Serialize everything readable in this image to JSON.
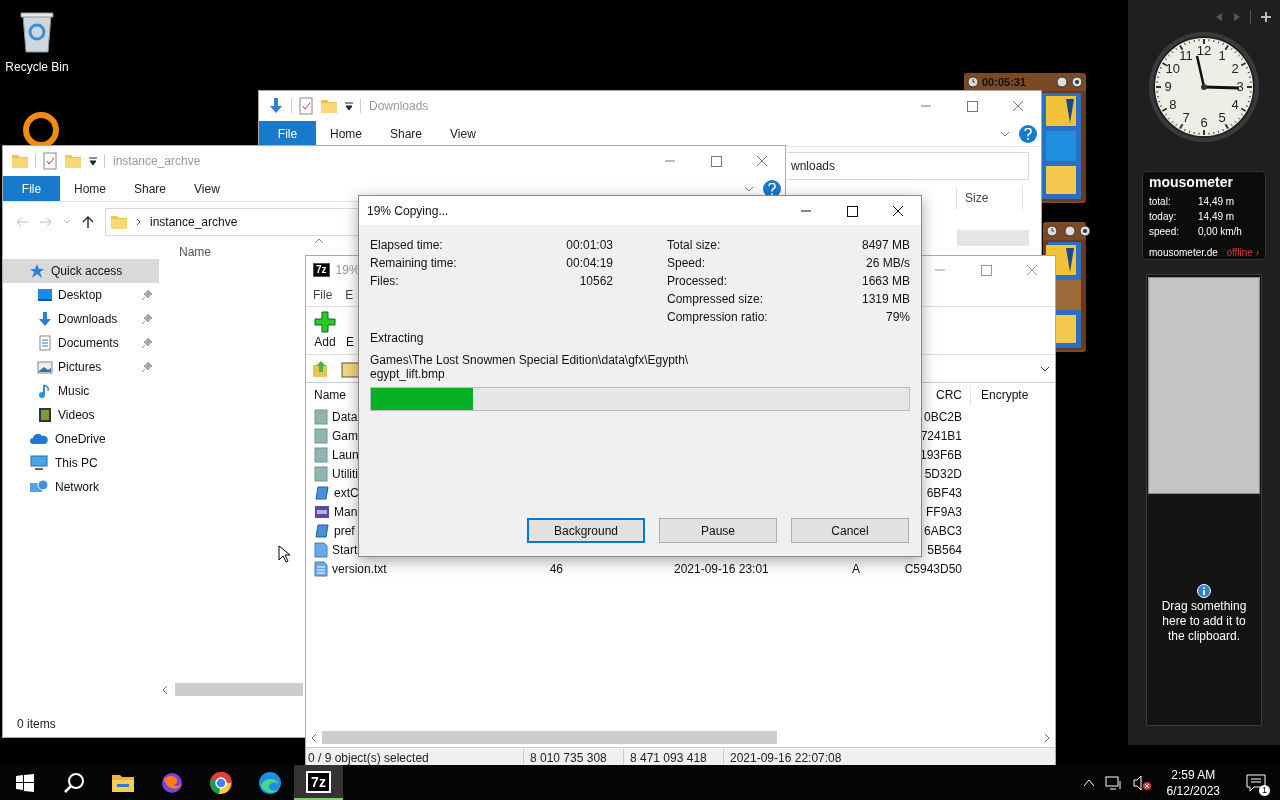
{
  "desktop_icons": [
    {
      "label": "Recycle Bin"
    }
  ],
  "timer_gadget": {
    "time": "00:05:31"
  },
  "downloads_window": {
    "title": "Downloads",
    "ribbon_tabs": [
      {
        "label": "File",
        "kind": "file"
      },
      {
        "label": "Home",
        "kind": "tab"
      },
      {
        "label": "Share",
        "kind": "tab"
      },
      {
        "label": "View",
        "kind": "tab"
      }
    ],
    "address": "wnloads",
    "column": "Size"
  },
  "explorer_window": {
    "title": "instance_archve",
    "ribbon_tabs": [
      {
        "label": "File",
        "kind": "file"
      },
      {
        "label": "Home",
        "kind": "tab"
      },
      {
        "label": "Share",
        "kind": "tab"
      },
      {
        "label": "View",
        "kind": "tab"
      }
    ],
    "address": "instance_archve",
    "column": "Name",
    "nav": [
      {
        "label": "Quick access",
        "selected": true,
        "children": [
          {
            "label": "Desktop",
            "pinned": true,
            "selected": false
          },
          {
            "label": "Downloads",
            "pinned": true,
            "selected": false
          },
          {
            "label": "Documents",
            "pinned": true,
            "selected": false
          },
          {
            "label": "Pictures",
            "pinned": true,
            "selected": false
          },
          {
            "label": "Music",
            "pinned": false,
            "selected": false
          },
          {
            "label": "Videos",
            "pinned": false,
            "selected": false
          }
        ]
      },
      {
        "label": "OneDrive",
        "selected": false
      },
      {
        "label": "This PC",
        "selected": false
      },
      {
        "label": "Network",
        "selected": false
      }
    ],
    "status": "0 items"
  },
  "archive_window": {
    "app_icon": "7z",
    "title": "19%",
    "menu": [
      "File",
      "E"
    ],
    "toolbar": [
      "Add",
      "E"
    ],
    "columns": [
      "Name",
      "CRC",
      "Encrypte"
    ],
    "rows": [
      {
        "kind": "folder",
        "name": "Data",
        "crc": "0BC2B"
      },
      {
        "kind": "folder",
        "name": "Gam",
        "crc": "7241B1"
      },
      {
        "kind": "folder",
        "name": "Laun",
        "crc": "193F6B"
      },
      {
        "kind": "folder",
        "name": "Utiliti",
        "crc": "5D32D"
      },
      {
        "kind": "app",
        "name": "extC",
        "crc": "6BF43"
      },
      {
        "kind": "pdf",
        "name": "Man",
        "crc": "FF9A3"
      },
      {
        "kind": "app",
        "name": "pref",
        "crc": "6ABC3"
      },
      {
        "kind": "file",
        "name": "Start",
        "crc": "5B564"
      },
      {
        "kind": "text",
        "name": "version.txt",
        "size": "46",
        "modified": "2021-09-16 23:01",
        "attributes": "A",
        "crc": "C5943D50"
      }
    ],
    "status": [
      "0 / 9 object(s) selected",
      "8 010 735 308",
      "8 471 093 418",
      "2021-09-16 22:07:08"
    ]
  },
  "copy_dialog": {
    "title": "19% Copying...",
    "stats_left": [
      {
        "label": "Elapsed time:",
        "value": "00:01:03"
      },
      {
        "label": "Remaining time:",
        "value": "00:04:19"
      },
      {
        "label": "Files:",
        "value": "10562"
      }
    ],
    "stats_right": [
      {
        "label": "Total size:",
        "value": "8497 MB"
      },
      {
        "label": "Speed:",
        "value": "26 MB/s"
      },
      {
        "label": "Processed:",
        "value": "1663 MB"
      },
      {
        "label": "Compressed size:",
        "value": "1319 MB"
      },
      {
        "label": "Compression ratio:",
        "value": "79%"
      }
    ],
    "action": "Extracting",
    "path": [
      "Games\\The Lost Snowmen Special Edition\\data\\gfx\\Egypth\\",
      "egypt_lift.bmp"
    ],
    "progress": {
      "level": 0.19
    },
    "buttons": [
      {
        "label": "Background",
        "focused": true
      },
      {
        "label": "Pause",
        "focused": false
      },
      {
        "label": "Cancel",
        "focused": false
      }
    ]
  },
  "sidebar": {
    "clock": {
      "numerals": [
        "12",
        "11",
        "1",
        "10",
        "2",
        "9",
        "3",
        "8",
        "4",
        "7",
        "5",
        "6"
      ]
    },
    "mousometer": {
      "title": "mousometer",
      "stats": [
        {
          "label": "total:",
          "value": "14,49 m"
        },
        {
          "label": "today:",
          "value": "14,49 m"
        },
        {
          "label": "speed:",
          "value": "0,00 km/h"
        }
      ],
      "link": "mousometer.de",
      "status": "offline ›"
    },
    "clipboard": {
      "hint": "Drag something here to add it to the clipboard."
    }
  },
  "taskbar": {
    "buttons": [
      {
        "kind": "start",
        "selected": false
      },
      {
        "kind": "search",
        "selected": false
      },
      {
        "kind": "folder",
        "selected": false
      },
      {
        "kind": "fox",
        "selected": false
      },
      {
        "kind": "ball",
        "selected": false
      },
      {
        "kind": "wave",
        "selected": false
      },
      {
        "kind": "archiver",
        "label": "7z",
        "selected": true
      }
    ],
    "time": "2:59 AM",
    "date": "6/12/2023",
    "notifications": "1"
  }
}
